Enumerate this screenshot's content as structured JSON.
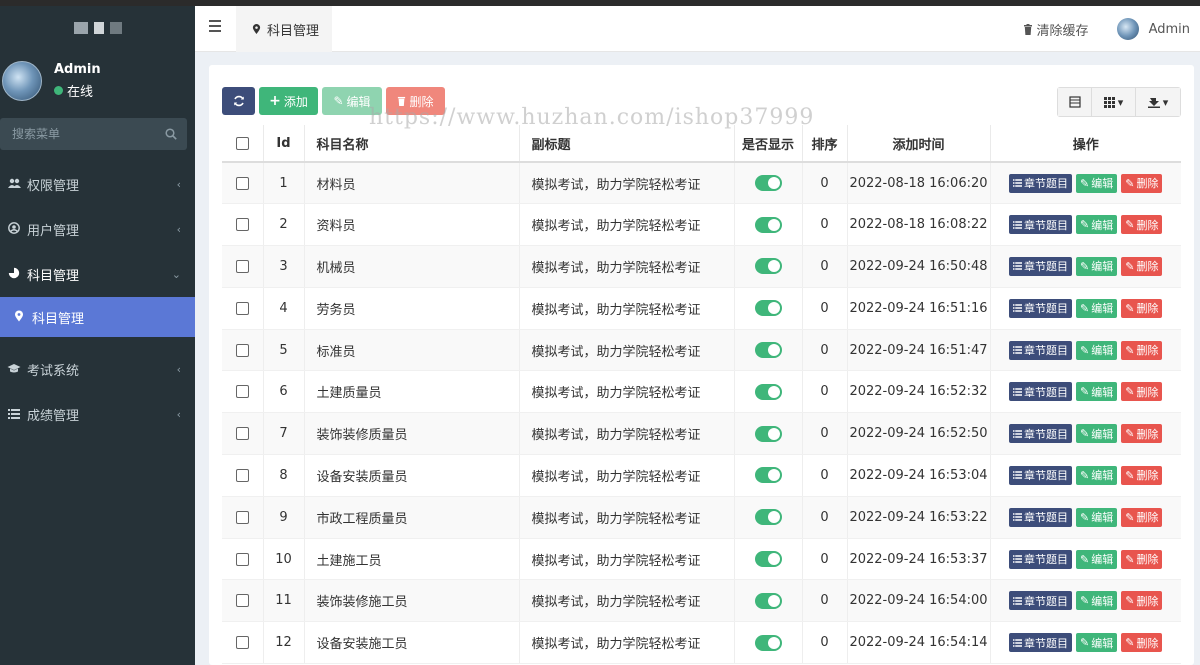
{
  "sidebar": {
    "user_name": "Admin",
    "user_status": "在线",
    "search_placeholder": "搜索菜单",
    "menu": [
      {
        "label": "权限管理",
        "icon": "users-icon"
      },
      {
        "label": "用户管理",
        "icon": "user-circle-icon"
      },
      {
        "label": "科目管理",
        "icon": "pie-chart-icon"
      },
      {
        "label": "科目管理",
        "icon": "map-marker-icon"
      },
      {
        "label": "考试系统",
        "icon": "graduation-cap-icon"
      },
      {
        "label": "成绩管理",
        "icon": "list-icon"
      }
    ]
  },
  "header": {
    "tab_label": "科目管理",
    "clear_cache": "清除缓存",
    "admin": "Admin"
  },
  "toolbar": {
    "add": "添加",
    "edit": "编辑",
    "delete": "删除"
  },
  "watermark": "https://www.huzhan.com/ishop37999",
  "table": {
    "headers": {
      "id": "Id",
      "name": "科目名称",
      "subtitle": "副标题",
      "show": "是否显示",
      "sort": "排序",
      "time": "添加时间",
      "ops": "操作"
    },
    "op_labels": {
      "chapter": "章节题目",
      "edit": "编辑",
      "delete": "删除"
    },
    "rows": [
      {
        "id": "1",
        "name": "材料员",
        "subtitle": "模拟考试，助力学院轻松考证",
        "show": true,
        "sort": "0",
        "time": "2022-08-18 16:06:20"
      },
      {
        "id": "2",
        "name": "资料员",
        "subtitle": "模拟考试，助力学院轻松考证",
        "show": true,
        "sort": "0",
        "time": "2022-08-18 16:08:22"
      },
      {
        "id": "3",
        "name": "机械员",
        "subtitle": "模拟考试，助力学院轻松考证",
        "show": true,
        "sort": "0",
        "time": "2022-09-24 16:50:48"
      },
      {
        "id": "4",
        "name": "劳务员",
        "subtitle": "模拟考试，助力学院轻松考证",
        "show": true,
        "sort": "0",
        "time": "2022-09-24 16:51:16"
      },
      {
        "id": "5",
        "name": "标准员",
        "subtitle": "模拟考试，助力学院轻松考证",
        "show": true,
        "sort": "0",
        "time": "2022-09-24 16:51:47"
      },
      {
        "id": "6",
        "name": "土建质量员",
        "subtitle": "模拟考试，助力学院轻松考证",
        "show": true,
        "sort": "0",
        "time": "2022-09-24 16:52:32"
      },
      {
        "id": "7",
        "name": "装饰装修质量员",
        "subtitle": "模拟考试，助力学院轻松考证",
        "show": true,
        "sort": "0",
        "time": "2022-09-24 16:52:50"
      },
      {
        "id": "8",
        "name": "设备安装质量员",
        "subtitle": "模拟考试，助力学院轻松考证",
        "show": true,
        "sort": "0",
        "time": "2022-09-24 16:53:04"
      },
      {
        "id": "9",
        "name": "市政工程质量员",
        "subtitle": "模拟考试，助力学院轻松考证",
        "show": true,
        "sort": "0",
        "time": "2022-09-24 16:53:22"
      },
      {
        "id": "10",
        "name": "土建施工员",
        "subtitle": "模拟考试，助力学院轻松考证",
        "show": true,
        "sort": "0",
        "time": "2022-09-24 16:53:37"
      },
      {
        "id": "11",
        "name": "装饰装修施工员",
        "subtitle": "模拟考试，助力学院轻松考证",
        "show": true,
        "sort": "0",
        "time": "2022-09-24 16:54:00"
      },
      {
        "id": "12",
        "name": "设备安装施工员",
        "subtitle": "模拟考试，助力学院轻松考证",
        "show": true,
        "sort": "0",
        "time": "2022-09-24 16:54:14"
      }
    ]
  },
  "colors": {
    "sidebar_bg": "#263238",
    "active_menu": "#5b78d6",
    "success": "#3fb67a",
    "danger": "#e8554e",
    "primary_dark": "#3d4d7a"
  }
}
